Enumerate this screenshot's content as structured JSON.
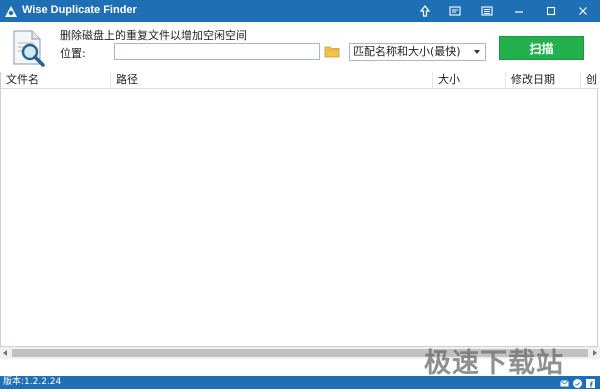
{
  "window": {
    "title": "Wise Duplicate Finder",
    "controls": [
      "upgrade-icon",
      "feedback-icon",
      "menu-icon",
      "minimize-icon",
      "maximize-icon",
      "close-icon"
    ]
  },
  "header": {
    "subtitle": "删除磁盘上的重复文件以增加空闲空间",
    "location_label": "位置:",
    "location_value": "",
    "match_mode": "匹配名称和大小(最快)",
    "scan_label": "扫描"
  },
  "table": {
    "columns": [
      "文件名",
      "路径",
      "大小",
      "修改日期",
      "创"
    ],
    "rows": []
  },
  "status": {
    "version": "版本:1.2.2.24",
    "social": [
      "email-icon",
      "twitter-icon",
      "facebook-icon"
    ]
  },
  "watermark": "极速下载站",
  "colors": {
    "titlebar": "#1f6fb5",
    "scan_button": "#22b14c",
    "statusbar": "#1f6fb5"
  }
}
